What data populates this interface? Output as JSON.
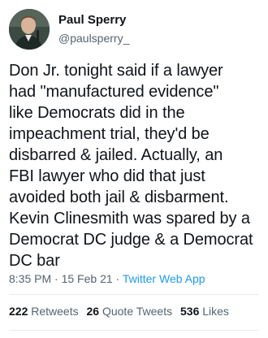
{
  "user": {
    "display_name": "Paul Sperry",
    "handle": "@paulsperry_"
  },
  "tweet": {
    "text": "Don Jr. tonight said if a lawyer\nhad \"manufactured evidence\"\nlike Democrats did in the\nimpeachment trial, they'd be\ndisbarred & jailed. Actually, an\nFBI lawyer who did that just\navoided both jail & disbarment.\nKevin Clinesmith was spared by a\nDemocrat DC judge & a Democrat\nDC bar",
    "time": "8:35 PM",
    "date": "15 Feb 21",
    "source": "Twitter Web App",
    "separator": "·"
  },
  "stats": {
    "retweets_count": "222",
    "retweets_label": "Retweets",
    "quote_count": "26",
    "quote_label": "Quote Tweets",
    "likes_count": "536",
    "likes_label": "Likes"
  },
  "colors": {
    "text": "#0f1419",
    "muted": "#536471",
    "link": "#1d9bf0",
    "divider": "#e6ecf0"
  }
}
